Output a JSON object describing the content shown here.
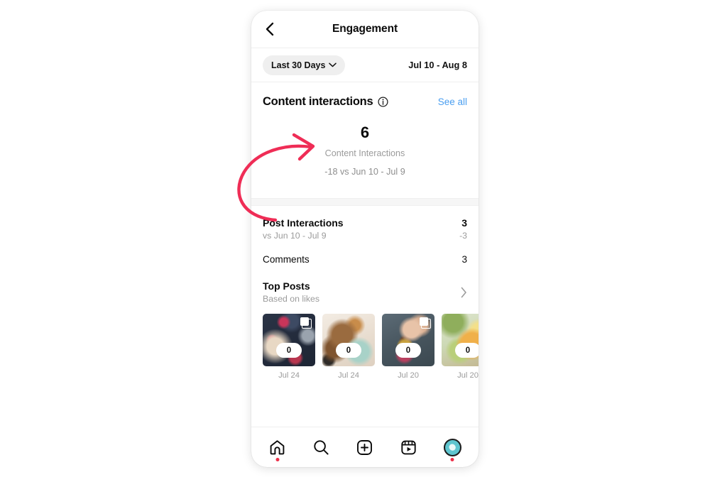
{
  "header": {
    "title": "Engagement",
    "back_icon": "chevron-left-icon"
  },
  "date_filter": {
    "pill_label": "Last 30 Days",
    "chevron_icon": "chevron-down-icon",
    "range": "Jul 10 - Aug 8"
  },
  "content_interactions": {
    "title": "Content interactions",
    "info_icon": "info-circle-icon",
    "see_all": "See all",
    "value": "6",
    "label": "Content Interactions",
    "delta": "-18 vs Jun 10 - Jul 9"
  },
  "stats": [
    {
      "name": "Post Interactions",
      "sub": "vs Jun 10 - Jul 9",
      "value": "3",
      "value_sub": "-3"
    },
    {
      "name": "Comments",
      "sub": "",
      "value": "3",
      "value_sub": ""
    }
  ],
  "top_posts": {
    "title": "Top Posts",
    "sub": "Based on likes",
    "chevron_icon": "chevron-right-icon",
    "items": [
      {
        "date": "Jul 24",
        "count": "0",
        "multi": true,
        "photo": "berry-tart-on-dark-slate"
      },
      {
        "date": "Jul 24",
        "count": "0",
        "multi": false,
        "photo": "carrot-cake-slices-light"
      },
      {
        "date": "Jul 20",
        "count": "0",
        "multi": true,
        "photo": "hand-reaching-dessert-jar"
      },
      {
        "date": "Jul 20",
        "count": "0",
        "multi": false,
        "photo": "layered-green-yellow-cake"
      }
    ]
  },
  "bottom_nav": [
    {
      "icon": "home-icon",
      "badge": true
    },
    {
      "icon": "search-icon",
      "badge": false
    },
    {
      "icon": "create-icon",
      "badge": false
    },
    {
      "icon": "reels-icon",
      "badge": false
    },
    {
      "icon": "profile-avatar-icon",
      "badge": true
    }
  ],
  "annotation": {
    "type": "curved-arrow",
    "color": "#ef2d56",
    "points_to": "content-interactions-value"
  }
}
